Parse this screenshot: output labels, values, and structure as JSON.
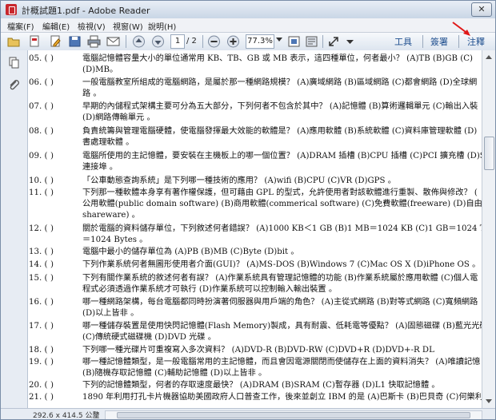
{
  "window": {
    "title": "計概試題1.pdf - Adobe Reader",
    "close": "✕"
  },
  "menu": [
    "檔案(F)",
    "編輯(E)",
    "檢視(V)",
    "視窗(W)",
    "說明(H)"
  ],
  "toolbar": {
    "page_current": "1",
    "page_total": "/ 2",
    "zoom": "77.3%",
    "tools_label": "工具",
    "sign_label": "簽署",
    "comment_label": "注釋"
  },
  "questions": [
    {
      "num": "05. (",
      "paren": ")",
      "lines": [
        "電腦記憶體容量大小的單位通常用 KB、TB、GB 或 MB 表示，這四種單位，何者最小？ (A)TB  (B)GB  (C)",
        "(D)MB。"
      ]
    },
    {
      "num": "06. (",
      "paren": ")",
      "lines": [
        "一般電腦教室所組成的電腦網路，是屬於那一種網路規模？ (A)廣域網路 (B)區域網路 (C)都會網路 (D)全球網",
        "路 。"
      ]
    },
    {
      "num": "07. (",
      "paren": ")",
      "lines": [
        "早期的內儲程式架構主要可分為五大部分，下列何者不包含於其中？ (A)記憶體 (B)算術邏輯單元 (C)輸出入裝",
        "(D)網路傳輸單元 。"
      ]
    },
    {
      "num": "08. (",
      "paren": ")",
      "lines": [
        "負責統籌與管理電腦硬體，使電腦發揮最大效能的軟體是？ (A)應用軟體 (B)系統軟體 (C)資料庫管理軟體 (D)",
        "書處理軟體 。"
      ]
    },
    {
      "num": "09. (",
      "paren": ")",
      "lines": [
        "電腦所使用的主記憶體，要安裝在主機板上的哪一個位置？ (A)DRAM 插槽 (B)CPU 插槽 (C)PCI 擴充槽 (D)S",
        "連接埠 。"
      ]
    },
    {
      "num": "10. (",
      "paren": ")",
      "lines": [
        "「公車動態查詢系統」是下列哪一種技術的應用？ (A)wifi (B)CPU (C)VR (D)GPS 。"
      ]
    },
    {
      "num": "11. (",
      "paren": ")",
      "lines": [
        "下列那一種軟體本身享有著作權保護，但可藉由 GPL 的型式，允許使用者對該軟體進行重製、散佈與修改？ (",
        "公用軟體(public domain software) (B)商用軟體(commerical software) (C)免費軟體(freeware) (D)自由軟體(free",
        "shareware) 。"
      ]
    },
    {
      "num": "12. (",
      "paren": ")",
      "lines": [
        "關於電腦的資料儲存單位，下列敘述何者錯誤？ (A)1000 KB＜1 GB (B)1 MB＝1024 KB (C)1 GB＝1024 TB (D)1 M",
        "＝1024 Bytes 。"
      ]
    },
    {
      "num": "13. (",
      "paren": ")",
      "lines": [
        "電腦中最小的儲存單位為 (A)PB (B)MB (C)Byte (D)bit 。"
      ]
    },
    {
      "num": "14. (",
      "paren": ")",
      "lines": [
        "下列作業系統何者無圖形使用者介面(GUI)？ (A)MS-DOS (B)Windows 7 (C)Mac OS X (D)iPhone OS 。"
      ]
    },
    {
      "num": "15. (",
      "paren": ")",
      "lines": [
        "下列有關作業系統的敘述何者有誤？ (A)作業系統具有管理記憶體的功能 (B)作業系統屬於應用軟體 (C)個人電",
        "程式必須透過作業系統才可執行 (D)作業系統可以控制輸入輸出裝置 。"
      ]
    },
    {
      "num": "16. (",
      "paren": ")",
      "lines": [
        "哪一種網路架構，每台電腦都同時扮演著伺服器與用戶端的角色？ (A)主從式網路 (B)對等式網路 (C)寬頻網路",
        "(D)以上皆非 。"
      ]
    },
    {
      "num": "17. (",
      "paren": ")",
      "lines": [
        "哪一種儲存裝置是使用快閃記憶體(Flash Memory)製成，具有耐震、低耗電等優點？ (A)固態磁碟 (B)藍光光碟",
        "(C)傳統硬式磁碟機 (D)DVD 光碟 。"
      ]
    },
    {
      "num": "18. (",
      "paren": ")",
      "lines": [
        "下列哪一種光碟片可重複寫入多次資料？ (A)DVD-R      (B)DVD-RW      (C)DVD+R      (D)DVD+-R DL"
      ]
    },
    {
      "num": "19. (",
      "paren": ")",
      "lines": [
        "哪一種記憶體類型，是一般電腦常用的主記憶體，而且會因電源關閉而使儲存在上面的資料消失？ (A)唯讀記憶",
        "(B)隨機存取記憶體 (C)輔助記憶體 (D)以上皆非 。"
      ]
    },
    {
      "num": "20. (",
      "paren": ")",
      "lines": [
        "下列的記憶體類型，何者的存取速度最快？ (A)DRAM (B)SRAM (C)暫存器 (D)L1 快取記憶體 。"
      ]
    },
    {
      "num": "21. (",
      "paren": ")",
      "lines": [
        "1890 年利用打孔卡片機器協助美國政府人口普查工作，後來並創立 IBM 的是 (A)巴斯卡 (B)巴貝奇 (C)何樂利"
      ]
    }
  ],
  "status": {
    "page_size": "292.6 x 414.5 公釐"
  }
}
